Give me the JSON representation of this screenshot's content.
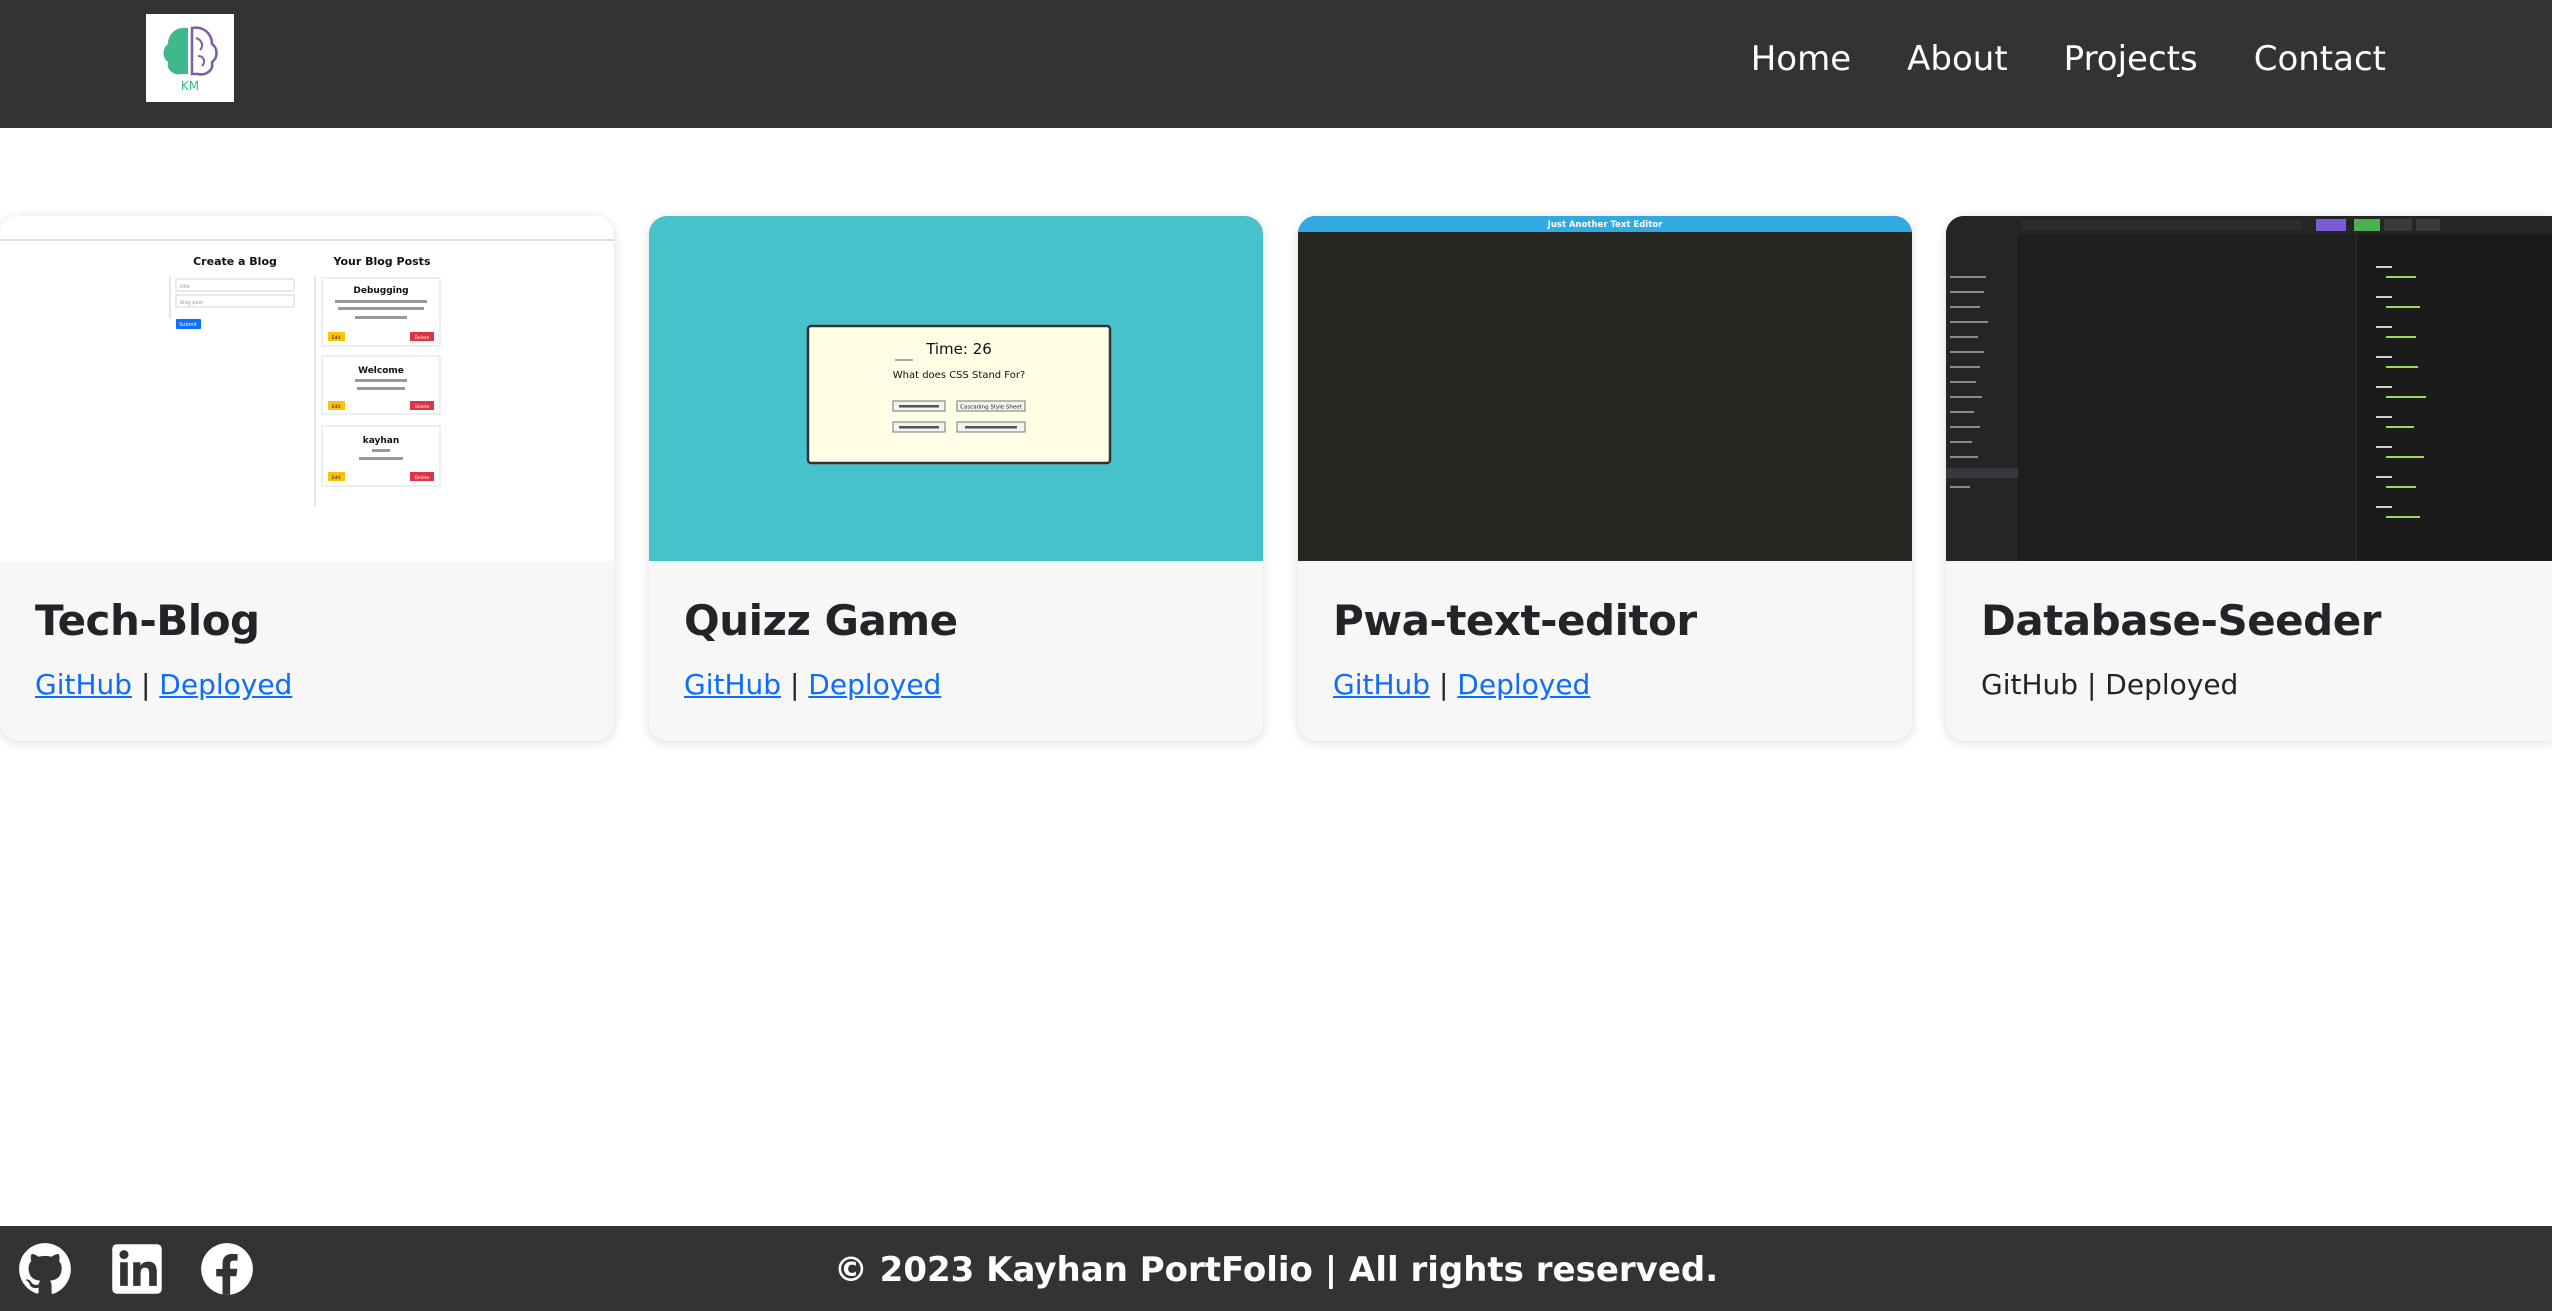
{
  "header": {
    "logo_text": "KM",
    "nav": [
      {
        "label": "Home"
      },
      {
        "label": "About"
      },
      {
        "label": "Projects"
      },
      {
        "label": "Contact"
      }
    ]
  },
  "projects": [
    {
      "title": "Tech-Blog",
      "github": "GitHub",
      "separator": "|",
      "deployed": "Deployed",
      "thumb": {
        "create_heading": "Create a Blog",
        "posts_heading": "Your Blog Posts",
        "title_placeholder": "title",
        "body_placeholder": "blog post",
        "submit": "Submit",
        "posts": [
          {
            "title": "Debugging",
            "edit": "Edit",
            "delete": "Delete"
          },
          {
            "title": "Welcome",
            "edit": "Edit",
            "delete": "Delete"
          },
          {
            "title": "kayhan",
            "edit": "Edit",
            "delete": "Delete"
          }
        ]
      }
    },
    {
      "title": "Quizz Game",
      "github": "GitHub",
      "separator": "|",
      "deployed": "Deployed",
      "thumb": {
        "timer": "Time: 26",
        "question": "What does CSS Stand For?",
        "answers": [
          "Cascading Style Sheet"
        ]
      }
    },
    {
      "title": "Pwa-text-editor",
      "github": "GitHub",
      "separator": "|",
      "deployed": "Deployed",
      "thumb": {
        "banner": "Just Another Text Editor"
      }
    },
    {
      "title": "Database-Seeder",
      "github": "GitHub",
      "separator": "|",
      "deployed": "Deployed",
      "thumb": {}
    }
  ],
  "footer": {
    "copyright": "© 2023 Kayhan PortFolio | All rights reserved.",
    "social": [
      {
        "icon": "github-icon"
      },
      {
        "icon": "linkedin-icon"
      },
      {
        "icon": "facebook-icon"
      }
    ]
  },
  "colors": {
    "header_bg": "#333333",
    "link": "#0d6efd",
    "quiz_bg": "#47c2cb",
    "editor_bg": "#272822",
    "editor_banner": "#31a9e1"
  }
}
